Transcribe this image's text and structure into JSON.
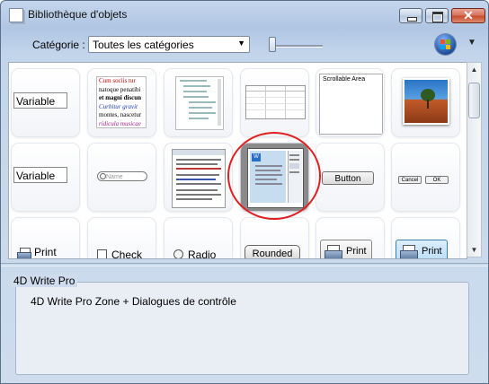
{
  "window": {
    "title": "Bibliothèque d'objets",
    "close_label": "✕"
  },
  "toolbar": {
    "category_label": "Catégorie :",
    "category_value": "Toutes les catégories"
  },
  "tiles": {
    "var1": "Variable",
    "var2": "Variable",
    "text_preview": [
      "Cum sociis tur",
      "natoque penatibi",
      "et magni discun",
      "Curbitur gravit",
      "montes, nascetur",
      "ridicula musicae"
    ],
    "scrollable_area": "Scrollable Area",
    "search_placeholder": "Name",
    "button": "Button",
    "cancel": "Cancel",
    "ok": "OK",
    "print": "Print",
    "check": "Check",
    "radio": "Radio",
    "rounded": "Rounded",
    "print_btn1": "Print",
    "print_btn2": "Print"
  },
  "detail": {
    "group_title": "4D Write Pro",
    "description": "4D Write Pro Zone + Dialogues de contrôle"
  },
  "colors": {
    "accent": "#3a7bd5",
    "highlight": "#e02020"
  }
}
